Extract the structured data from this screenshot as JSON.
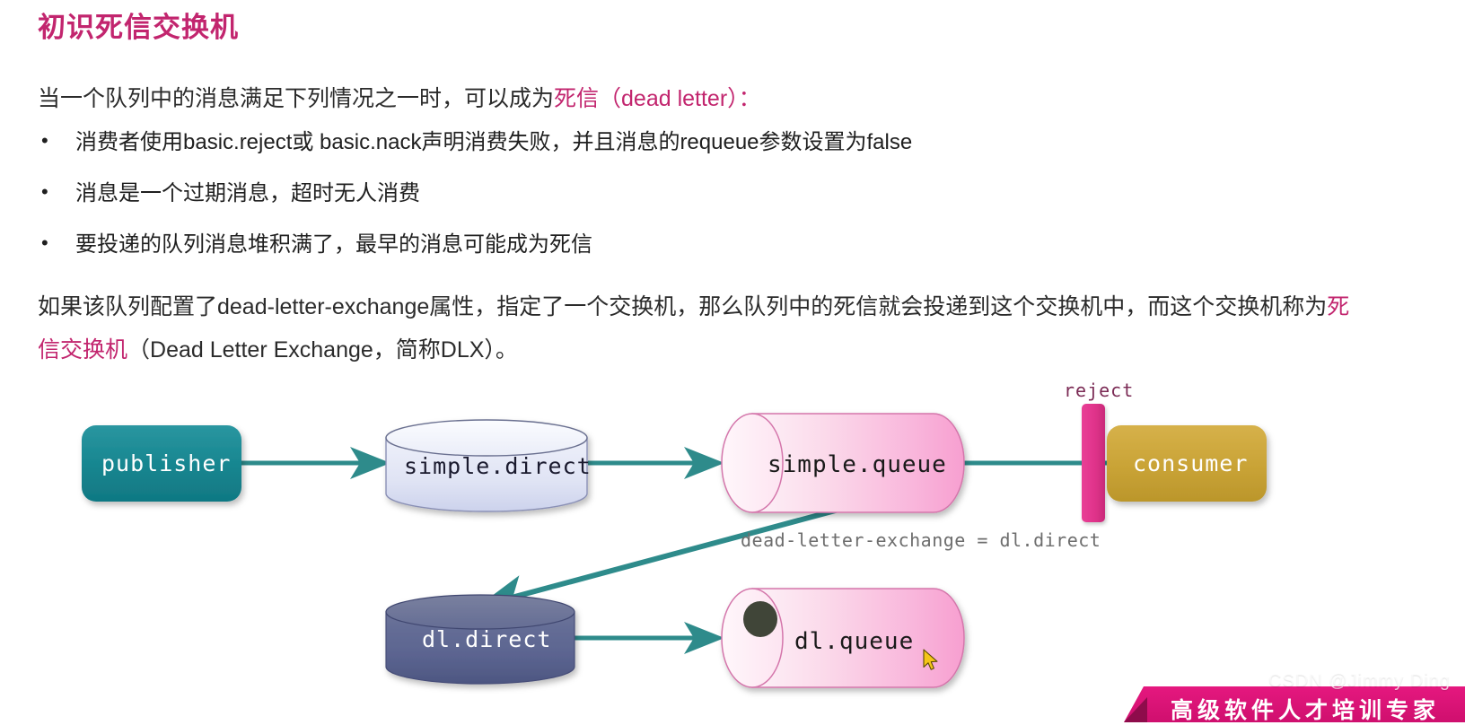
{
  "slide": {
    "title": "初识死信交换机",
    "intro": {
      "prefix": "当一个队列中的消息满足下列情况之一时，可以成为",
      "highlight": "死信（dead letter）",
      "suffix": "："
    },
    "bullet_marker": "•",
    "bullets": [
      "消费者使用basic.reject或 basic.nack声明消费失败，并且消息的requeue参数设置为false",
      "消息是一个过期消息，超时无人消费",
      "要投递的队列消息堆积满了，最早的消息可能成为死信"
    ],
    "closing": {
      "part1": "如果该队列配置了dead-letter-exchange属性，指定了一个交换机，那么队列中的死信就会投递到这个交换机中，而这个交换机称为",
      "highlight": "死信交换机",
      "part2": "（Dead Letter Exchange，简称DLX）。"
    }
  },
  "diagram": {
    "type": "flow",
    "nodes": [
      {
        "id": "publisher",
        "label": "publisher",
        "shape": "rounded-rect",
        "color": "#1a868f"
      },
      {
        "id": "simple.direct",
        "label": "simple.direct",
        "shape": "cylinder",
        "color": "#dde0f2"
      },
      {
        "id": "simple.queue",
        "label": "simple.queue",
        "shape": "cylinder-h",
        "color": "#f9a8d4"
      },
      {
        "id": "reject",
        "label": "reject",
        "shape": "bar",
        "color": "#e0338b"
      },
      {
        "id": "consumer",
        "label": "consumer",
        "shape": "rounded-rect",
        "color": "#c8a434"
      },
      {
        "id": "dl.direct",
        "label": "dl.direct",
        "shape": "cylinder",
        "color": "#5b6490"
      },
      {
        "id": "dl.queue",
        "label": "dl.queue",
        "shape": "cylinder-h",
        "color": "#f9a8d4"
      }
    ],
    "edges": [
      {
        "from": "publisher",
        "to": "simple.direct",
        "label": ""
      },
      {
        "from": "simple.direct",
        "to": "simple.queue",
        "label": ""
      },
      {
        "from": "simple.queue",
        "to": "consumer",
        "label": ""
      },
      {
        "from": "simple.queue",
        "to": "dl.direct",
        "label": "dead-letter-exchange = dl.direct"
      },
      {
        "from": "dl.direct",
        "to": "dl.queue",
        "label": ""
      }
    ],
    "annotations": {
      "reject": "reject",
      "dlx_attr": "dead-letter-exchange = dl.direct"
    },
    "arrow_color": "#2e8b8b"
  },
  "footer": {
    "banner_text": "高级软件人才培训专家",
    "watermark": "CSDN @Jimmy Ding",
    "banner_color": "#e5187f"
  },
  "cursor": {
    "icon": "arrow-pointer",
    "color": "#f5c518"
  }
}
